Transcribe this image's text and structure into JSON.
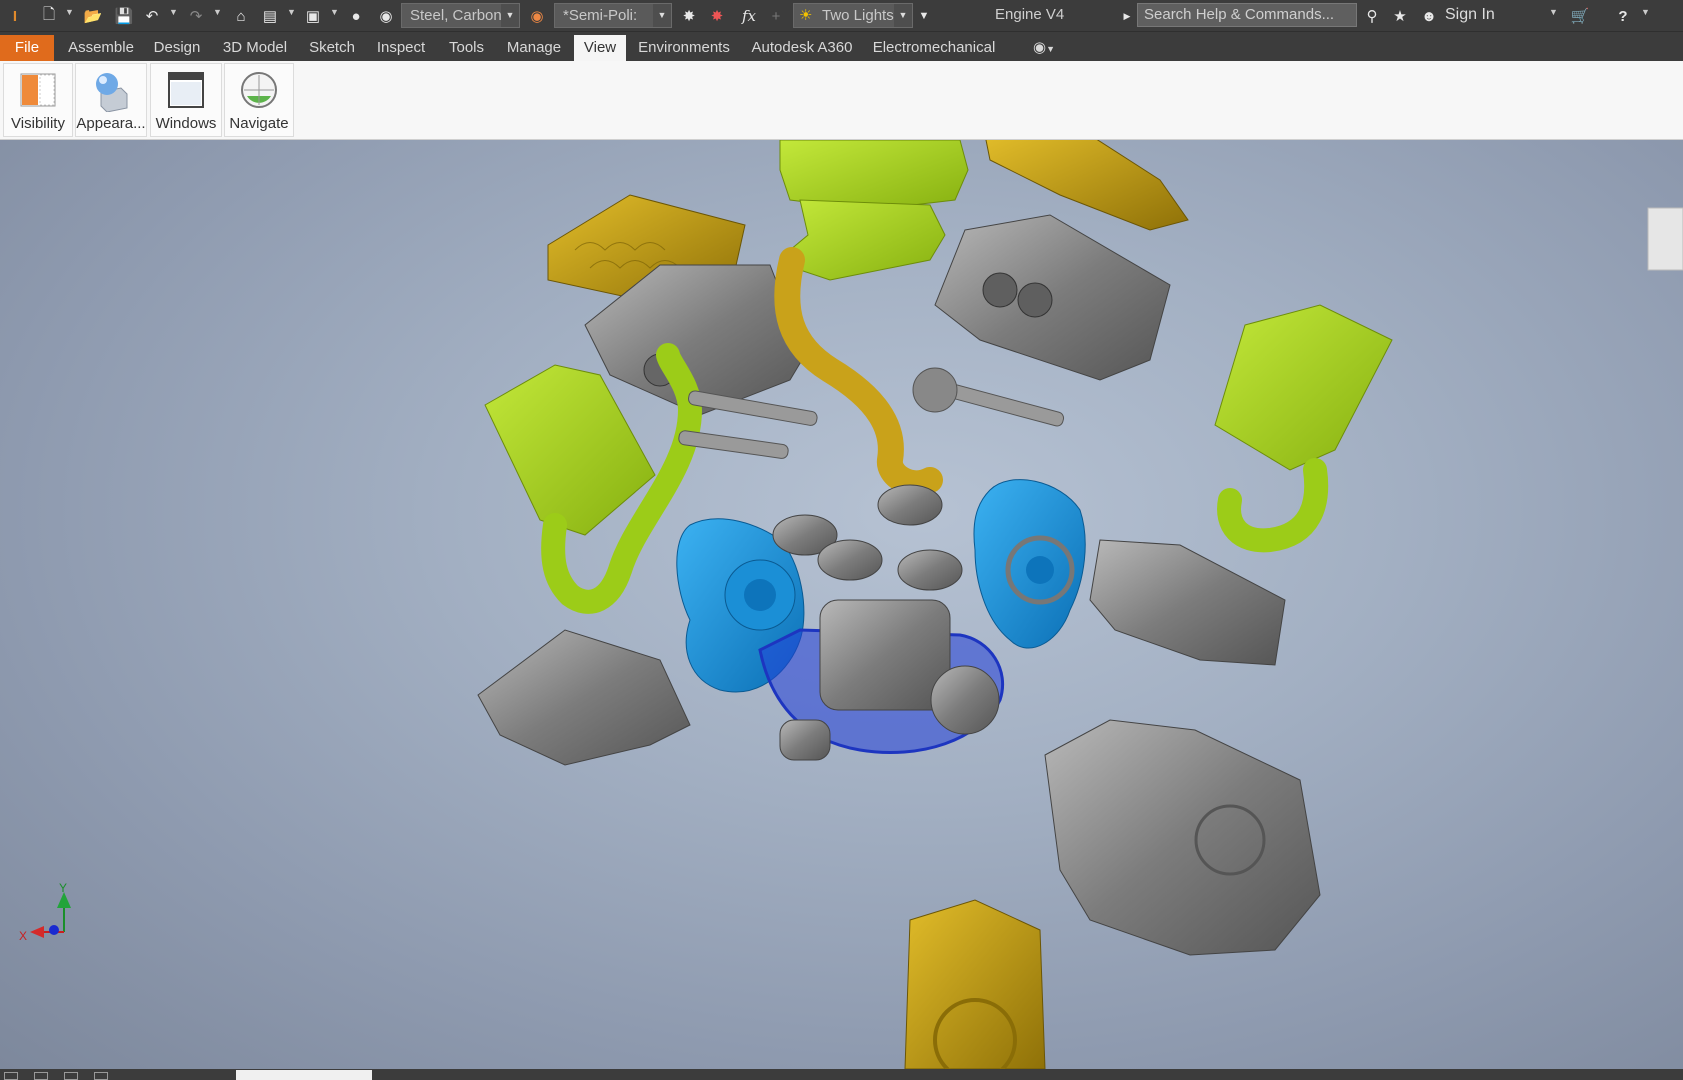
{
  "qat": {
    "material": "Steel, Carbon",
    "appearance": "*Semi-Poli:",
    "lighting": "Two Lights",
    "fx": "fx",
    "document_title": "Engine V4",
    "search_placeholder": "Search Help & Commands...",
    "sign_in": "Sign In"
  },
  "tabs": [
    {
      "label": "File"
    },
    {
      "label": "Assemble"
    },
    {
      "label": "Design"
    },
    {
      "label": "3D Model"
    },
    {
      "label": "Sketch"
    },
    {
      "label": "Inspect"
    },
    {
      "label": "Tools"
    },
    {
      "label": "Manage"
    },
    {
      "label": "View"
    },
    {
      "label": "Environments"
    },
    {
      "label": "Autodesk A360"
    },
    {
      "label": "Electromechanical"
    }
  ],
  "active_tab": "View",
  "ribbon": {
    "visibility": "Visibility",
    "appearance": "Appeara...",
    "windows": "Windows",
    "navigate": "Navigate"
  },
  "triad": {
    "x_label": "X",
    "y_label": "Y"
  },
  "colors": {
    "brand_orange": "#e06b1c",
    "part_green": "#9ccc18",
    "part_blue": "#1b8fd6",
    "part_gold": "#c9a21a",
    "part_grey": "#8a8a8a"
  },
  "icons": [
    "inventor-logo-icon",
    "new-file-icon",
    "open-icon",
    "save-icon",
    "undo-icon",
    "redo-icon",
    "home-icon",
    "viewcube-icon",
    "star-icon",
    "user-icon",
    "cart-icon",
    "help-icon"
  ]
}
